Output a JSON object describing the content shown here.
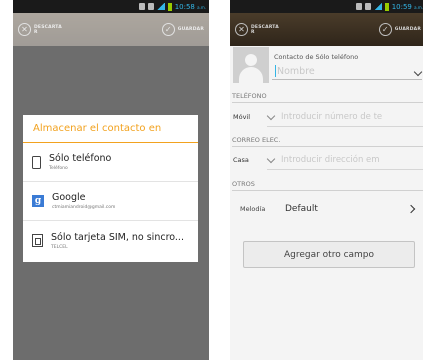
{
  "left_screen": {
    "status_time": "10:58",
    "status_ampm": "a.m.",
    "discard_label": "DESCARTA\nR",
    "save_label": "GUARDAR",
    "dialog": {
      "title": "Almacenar el contacto en",
      "options": [
        {
          "label": "Sólo teléfono",
          "sub": "Teléfono",
          "icon": "phone-icon"
        },
        {
          "label": "Google",
          "sub": "ctmiamiandroid@gmail.com",
          "icon": "google-icon"
        },
        {
          "label": "Sólo tarjeta SIM, no sincro...",
          "sub": "TELCEL",
          "icon": "sim-card-icon"
        }
      ]
    }
  },
  "right_screen": {
    "status_time": "10:59",
    "status_ampm": "a.m.",
    "discard_label": "DESCARTA\nR",
    "save_label": "GUARDAR",
    "contact_type": "Contacto de Sólo teléfono",
    "name_placeholder": "Nombre",
    "phone_section": "TELÉFONO",
    "phone_type": "Móvil",
    "phone_placeholder": "Introducir número de te",
    "email_section": "CORREO ELEC.",
    "email_type": "Casa",
    "email_placeholder": "Introducir dirección em",
    "others_section": "OTROS",
    "melody_label": "Melodía",
    "melody_value": "Default",
    "add_field_button": "Agregar otro campo"
  },
  "colors": {
    "accent_orange": "#f2a21f",
    "status_blue": "#33b5e5",
    "actionbar_brown": "#3c3022"
  }
}
